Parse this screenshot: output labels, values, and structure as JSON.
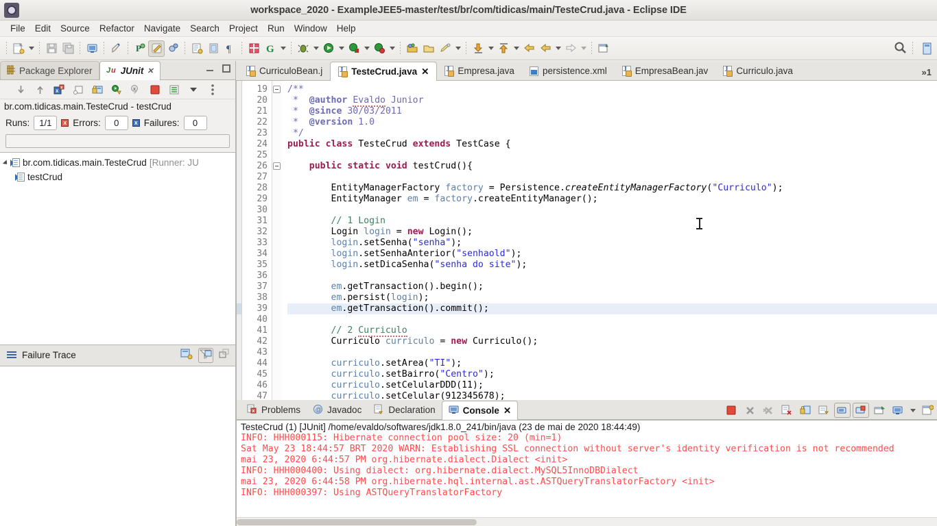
{
  "window": {
    "title": "workspace_2020 - ExampleJEE5-master/test/br/com/tidicas/main/TesteCrud.java - Eclipse IDE",
    "app_icon": "eclipse-icon"
  },
  "menubar": {
    "items": [
      "File",
      "Edit",
      "Source",
      "Refactor",
      "Navigate",
      "Search",
      "Project",
      "Run",
      "Window",
      "Help"
    ]
  },
  "toolbar": {
    "search_icon": "search-icon",
    "buttons": [
      "new-wizard",
      "save",
      "save-all",
      "print-preview",
      "quick-access-marker",
      "toggle-mark-occurrences",
      "open-task",
      "new-java-class",
      "new-java-package",
      "show-whitespace",
      "open-type",
      "next-annotation",
      "debug",
      "run",
      "run-coverage",
      "external-tools",
      "new-element",
      "open-resource",
      "search-reference",
      "previous-edit",
      "back",
      "forward",
      "pin-editor"
    ]
  },
  "left_panel": {
    "tabs": [
      {
        "label": "Package Explorer",
        "icon": "package-explorer-icon",
        "active": false,
        "closable": false
      },
      {
        "label": "JUnit",
        "icon": "junit-icon",
        "active": true,
        "closable": true
      }
    ],
    "view_buttons": [
      "minimize-view",
      "maximize-view"
    ],
    "junit": {
      "toolbar_buttons": [
        "next-failure-icon",
        "previous-failure-icon",
        "show-failures-only-icon",
        "show-tests-in-hierarchy-icon",
        "stop-on-failure-icon",
        "rerun-test-icon",
        "rerun-failed-tests-icon",
        "stop-icon",
        "test-run-history-icon",
        "view-menu-icon",
        "view-menu-dots-icon"
      ],
      "test_path": "br.com.tidicas.main.TesteCrud - testCrud",
      "stats": [
        {
          "label": "Runs:",
          "value": "1/1",
          "icon": ""
        },
        {
          "label": "Errors:",
          "value": "0",
          "icon": "error-icon"
        },
        {
          "label": "Failures:",
          "value": "0",
          "icon": "failure-icon"
        }
      ],
      "tree": [
        {
          "label": "br.com.tidicas.main.TesteCrud",
          "suffix": " [Runner: JU",
          "depth": 0,
          "expanded": true,
          "icon": "test-suite-icon"
        },
        {
          "label": "testCrud",
          "suffix": "",
          "depth": 1,
          "expanded": false,
          "icon": "test-case-icon"
        }
      ]
    },
    "failure_trace": {
      "title": "Failure Trace",
      "menu_icon": "failure-trace-menu-icon",
      "buttons": [
        "compare-result-icon",
        "filter-stack-trace-icon",
        "restore-icon"
      ]
    }
  },
  "editor": {
    "tabs": [
      {
        "label": "CurriculoBean.j",
        "icon": "java-file-icon",
        "active": false,
        "closable": false
      },
      {
        "label": "TesteCrud.java",
        "icon": "java-file-icon",
        "active": true,
        "closable": true
      },
      {
        "label": "Empresa.java",
        "icon": "java-file-icon",
        "active": false,
        "closable": false
      },
      {
        "label": "persistence.xml",
        "icon": "xml-file-icon",
        "active": false,
        "closable": false
      },
      {
        "label": "EmpresaBean.jav",
        "icon": "java-file-icon",
        "active": false,
        "closable": false
      },
      {
        "label": "Curriculo.java",
        "icon": "java-file-icon",
        "active": false,
        "closable": false
      }
    ],
    "tab_overflow": "»1",
    "first_line": 19,
    "highlighted_line": 39,
    "lines": [
      {
        "n": 19,
        "fold": true,
        "text": "/**"
      },
      {
        "n": 20,
        "fold": false,
        "text": " *  @author Evaldo Junior"
      },
      {
        "n": 21,
        "fold": false,
        "text": " *  @since 30/03/2011"
      },
      {
        "n": 22,
        "fold": false,
        "text": " *  @version 1.0"
      },
      {
        "n": 23,
        "fold": false,
        "text": " */"
      },
      {
        "n": 24,
        "fold": false,
        "text": "public class TesteCrud extends TestCase {"
      },
      {
        "n": 25,
        "fold": false,
        "text": ""
      },
      {
        "n": 26,
        "fold": true,
        "text": "    public static void testCrud(){"
      },
      {
        "n": 27,
        "fold": false,
        "text": ""
      },
      {
        "n": 28,
        "fold": false,
        "text": "        EntityManagerFactory factory = Persistence.createEntityManagerFactory(\"Curriculo\");"
      },
      {
        "n": 29,
        "fold": false,
        "text": "        EntityManager em = factory.createEntityManager();"
      },
      {
        "n": 30,
        "fold": false,
        "text": ""
      },
      {
        "n": 31,
        "fold": false,
        "text": "        // 1 Login"
      },
      {
        "n": 32,
        "fold": false,
        "text": "        Login login = new Login();"
      },
      {
        "n": 33,
        "fold": false,
        "text": "        login.setSenha(\"senha\");"
      },
      {
        "n": 34,
        "fold": false,
        "text": "        login.setSenhaAnterior(\"senhaold\");"
      },
      {
        "n": 35,
        "fold": false,
        "text": "        login.setDicaSenha(\"senha do site\");"
      },
      {
        "n": 36,
        "fold": false,
        "text": ""
      },
      {
        "n": 37,
        "fold": false,
        "text": "        em.getTransaction().begin();"
      },
      {
        "n": 38,
        "fold": false,
        "text": "        em.persist(login);"
      },
      {
        "n": 39,
        "fold": false,
        "text": "        em.getTransaction().commit();"
      },
      {
        "n": 40,
        "fold": false,
        "text": ""
      },
      {
        "n": 41,
        "fold": false,
        "text": "        // 2 Curriculo"
      },
      {
        "n": 42,
        "fold": false,
        "text": "        Curriculo curriculo = new Curriculo();"
      },
      {
        "n": 43,
        "fold": false,
        "text": ""
      },
      {
        "n": 44,
        "fold": false,
        "text": "        curriculo.setArea(\"TI\");"
      },
      {
        "n": 45,
        "fold": false,
        "text": "        curriculo.setBairro(\"Centro\");"
      },
      {
        "n": 46,
        "fold": false,
        "text": "        curriculo.setCelularDDD(11);"
      },
      {
        "n": 47,
        "fold": false,
        "text": "        curriculo.setCelular(912345678);"
      }
    ]
  },
  "bottom_panel": {
    "tabs": [
      {
        "label": "Problems",
        "icon": "problems-icon",
        "active": false,
        "closable": false
      },
      {
        "label": "Javadoc",
        "icon": "javadoc-icon",
        "active": false,
        "closable": false
      },
      {
        "label": "Declaration",
        "icon": "declaration-icon",
        "active": false,
        "closable": false
      },
      {
        "label": "Console",
        "icon": "console-icon",
        "active": true,
        "closable": true
      }
    ],
    "toolbar_buttons": [
      "terminate-icon",
      "remove-launch-icon",
      "remove-all-launches-icon",
      "clear-console-icon",
      "scroll-lock-icon",
      "word-wrap-icon",
      "show-console-on-output-icon",
      "show-console-on-error-icon",
      "pin-console-icon",
      "display-selected-console-icon",
      "console-menu-arrow-icon",
      "open-console-icon"
    ],
    "console": {
      "launch_line": "TesteCrud (1) [JUnit] /home/evaldo/softwares/jdk1.8.0_241/bin/java (23 de mai de 2020 18:44:49)",
      "lines": [
        "INFO: HHH000115: Hibernate connection pool size: 20 (min=1)",
        "Sat May 23 18:44:57 BRT 2020 WARN: Establishing SSL connection without server's identity verification is not recommended",
        "mai 23, 2020 6:44:57 PM org.hibernate.dialect.Dialect <init>",
        "INFO: HHH000400: Using dialect: org.hibernate.dialect.MySQL5InnoDBDialect",
        "mai 23, 2020 6:44:58 PM org.hibernate.hql.internal.ast.ASTQueryTranslatorFactory <init>",
        "INFO: HHH000397: Using ASTQueryTranslatorFactory"
      ]
    }
  },
  "colors": {
    "keyword": "#9b1b53",
    "string": "#2a2ae0",
    "comment": "#3f7f5f",
    "javadoc": "#6a6ab5",
    "local_var": "#5c7fa8",
    "console_error": "#ff4b4b",
    "current_line": "#e8eef7",
    "chrome": "#f1f0ee"
  }
}
